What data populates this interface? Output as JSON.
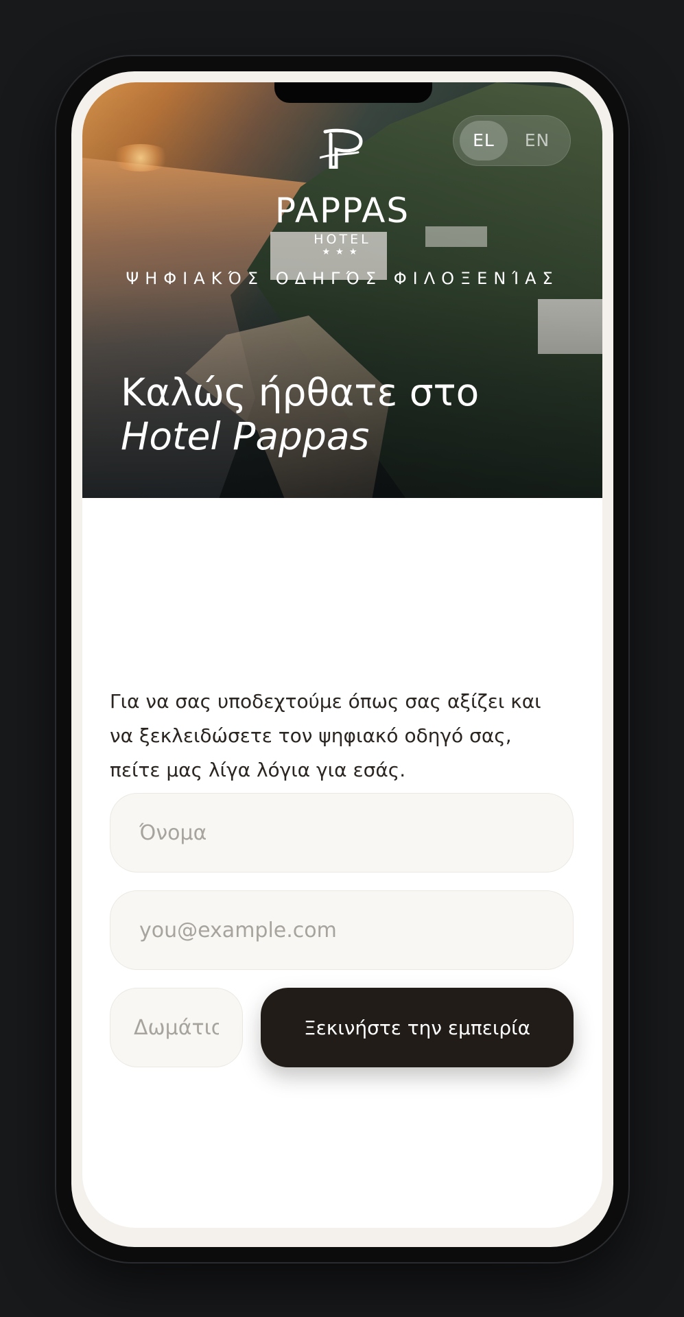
{
  "hero": {
    "logo_word": "PAPPAS",
    "logo_sub": "HOTEL",
    "logo_stars": "★★★",
    "tagline": "ΨΗΦΙΑΚΌΣ ΟΔΗΓΌΣ ΦΙΛΟΞΕΝΊΑΣ",
    "welcome_line1": "Καλώς ήρθατε στο",
    "welcome_line2": "Hotel Pappas"
  },
  "language": {
    "options": [
      "EL",
      "EN"
    ],
    "selected": "EL"
  },
  "form": {
    "intro": "Για να σας υποδεχτούμε όπως σας αξίζει και να ξεκλειδώσετε τον ψηφιακό οδηγό σας, πείτε μας λίγα λόγια για εσάς.",
    "name_placeholder": "Όνομα",
    "email_placeholder": "you@example.com",
    "room_placeholder": "Δωμάτιο",
    "submit_label": "Ξεκινήστε την εμπειρία"
  },
  "colors": {
    "background": "#18191b",
    "button": "#211c17",
    "field_bg": "#f8f7f4",
    "text": "#2a2520"
  }
}
